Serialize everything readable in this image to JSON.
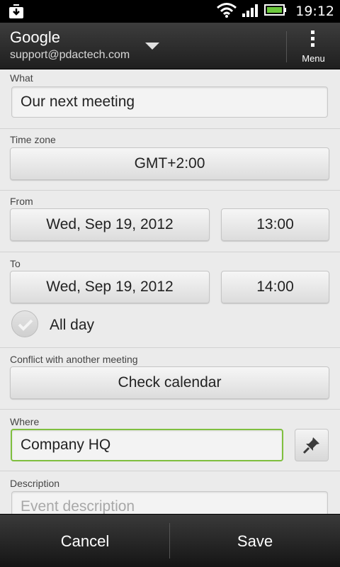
{
  "status_bar": {
    "time": "19:12",
    "icons": [
      "download-icon",
      "wifi-icon",
      "signal-icon",
      "battery-icon"
    ]
  },
  "action_bar": {
    "account_title": "Google",
    "account_email": "support@pdactech.com",
    "menu_label": "Menu"
  },
  "form": {
    "what": {
      "label": "What",
      "value": "Our next meeting"
    },
    "time_zone": {
      "label": "Time zone",
      "value": "GMT+2:00"
    },
    "from": {
      "label": "From",
      "date": "Wed, Sep 19, 2012",
      "time": "13:00"
    },
    "to": {
      "label": "To",
      "date": "Wed, Sep 19, 2012",
      "time": "14:00"
    },
    "all_day": {
      "label": "All day",
      "checked": false
    },
    "conflict": {
      "label": "Conflict with another meeting",
      "button": "Check calendar"
    },
    "where": {
      "label": "Where",
      "value": "Company HQ"
    },
    "description": {
      "label": "Description",
      "placeholder": "Event description"
    }
  },
  "bottom_bar": {
    "cancel_label": "Cancel",
    "save_label": "Save"
  },
  "colors": {
    "focus_border": "#7fbf3f",
    "battery_green": "#6cc83c"
  }
}
